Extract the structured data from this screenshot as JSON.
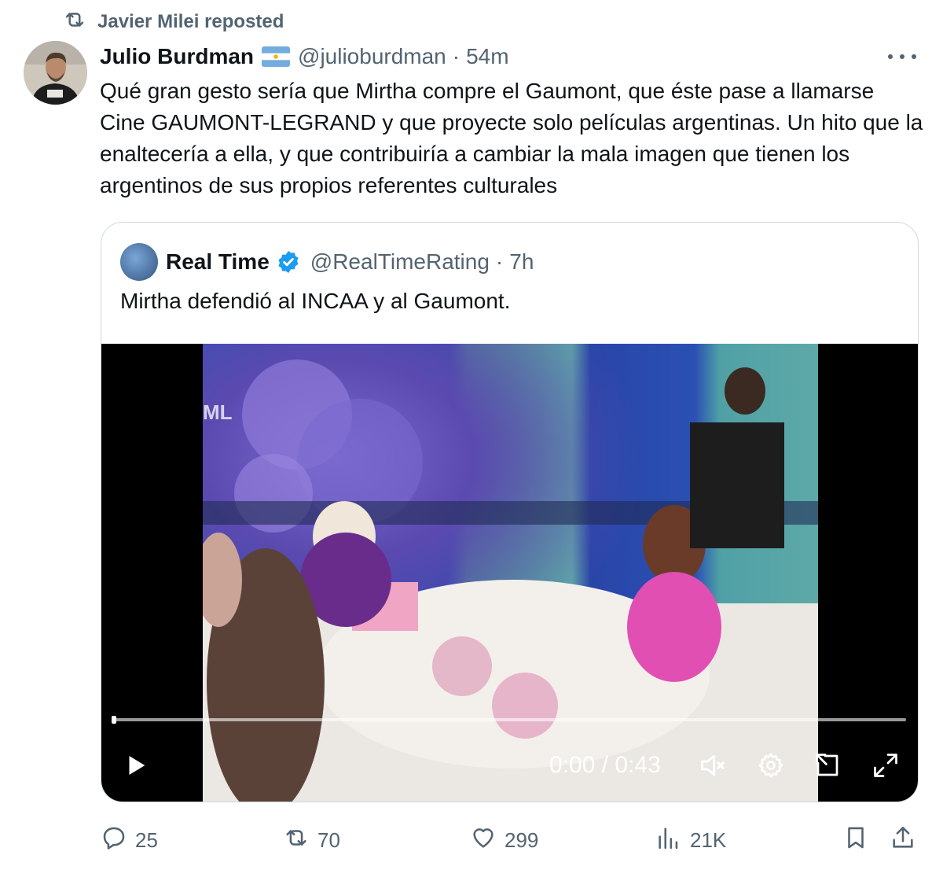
{
  "repost": {
    "label": "Javier Milei reposted"
  },
  "tweet": {
    "author_name": "Julio Burdman",
    "handle": "@julioburdman",
    "separator": "·",
    "time": "54m",
    "text": "Qué gran gesto sería que Mirtha compre el Gaumont, que éste pase a llamarse Cine GAUMONT-LEGRAND y que proyecte solo películas argentinas. Un hito que la enaltecería a ella, y que contribuiría a cambiar la mala imagen que tienen los argentinos de sus propios referentes culturales"
  },
  "quote": {
    "author_name": "Real Time",
    "handle": "@RealTimeRating",
    "separator": "·",
    "time": "7h",
    "text": "Mirtha defendió al INCAA y al Gaumont.",
    "verified": true
  },
  "video": {
    "watermark": "ML",
    "time_display": "0:00 / 0:43",
    "progress": 0,
    "muted": true
  },
  "actions": {
    "replies": "25",
    "reposts": "70",
    "likes": "299",
    "views": "21K"
  },
  "colors": {
    "text_primary": "#0f1419",
    "text_secondary": "#536471",
    "verified": "#1d9bf0",
    "border": "#cfd9de"
  },
  "icons": {
    "repost": "repost-icon",
    "more": "more-icon",
    "verified": "verified-badge-icon",
    "play": "play-icon",
    "mute": "volume-muted-icon",
    "settings": "gear-icon",
    "pip": "picture-in-picture-icon",
    "fullscreen": "fullscreen-icon",
    "reply": "reply-icon",
    "retweet": "repost-icon",
    "like": "heart-icon",
    "views": "views-icon",
    "bookmark": "bookmark-icon",
    "share": "share-icon"
  }
}
